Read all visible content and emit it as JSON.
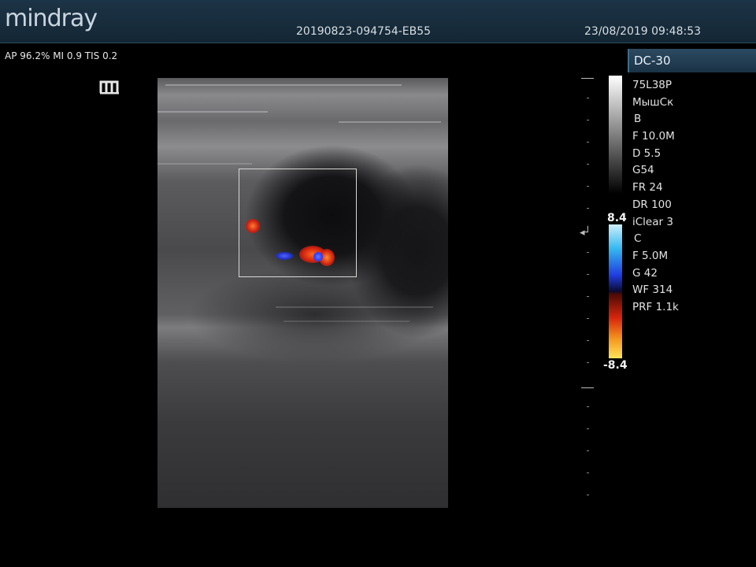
{
  "header": {
    "logo": "mindray",
    "exam_id": "20190823-094754-EB55",
    "datetime": "23/08/2019 09:48:53"
  },
  "acoustic_output": "AP 96.2%  MI 0.9 TIS 0.2",
  "probe_mode": "DC-30",
  "color_scale": {
    "top": "8.4",
    "bottom": "-8.4"
  },
  "params": [
    "75L38P",
    "МышСк",
    "B",
    "F 10.0M",
    "D 5.5",
    "G54",
    "FR 24",
    "DR 100",
    "iClear 3",
    "C",
    "F 5.0M",
    "G 42",
    "WF 314",
    "PRF 1.1k"
  ],
  "icons": [
    "mindray-m-icon",
    "focus-marker-icon"
  ],
  "colors": {
    "header_bg": "#1d3446",
    "roi_box": "#d8d8d8",
    "flow_red": "#e0301a",
    "flow_blue": "#2a3cff"
  }
}
